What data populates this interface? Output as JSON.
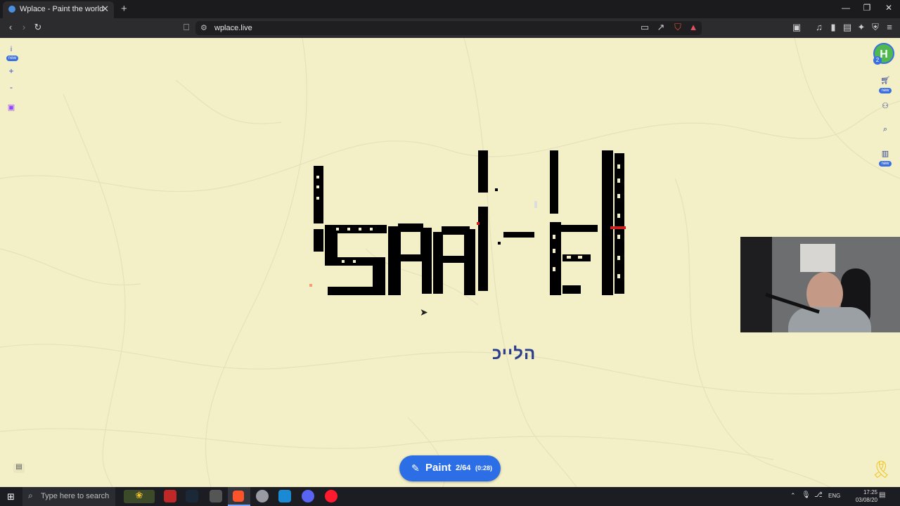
{
  "browser": {
    "tab_title": "Wplace - Paint the world",
    "new_tab_icon": "+",
    "url": "wplace.live",
    "window_controls": [
      "minimize",
      "maximize",
      "close"
    ]
  },
  "map": {
    "left_controls": {
      "info_icon": "i",
      "info_badge": "new",
      "zoom_in": "+",
      "zoom_out": "-"
    },
    "right_controls": {
      "avatar_letter": "H",
      "avatar_badge": "2",
      "store_badge": "new",
      "leaderboard_badge": "new"
    },
    "label_text": "הלייכ"
  },
  "paint_button": {
    "label": "Paint",
    "count": "2/64",
    "timer": "(0:28)"
  },
  "taskbar": {
    "search_placeholder": "Type here to search",
    "lang": "ENG",
    "time": "17:25",
    "date": "03/08/20"
  },
  "colors": {
    "map_bg": "#f3efc6",
    "accent": "#2c6ee6",
    "pixel_art": "#000000"
  }
}
